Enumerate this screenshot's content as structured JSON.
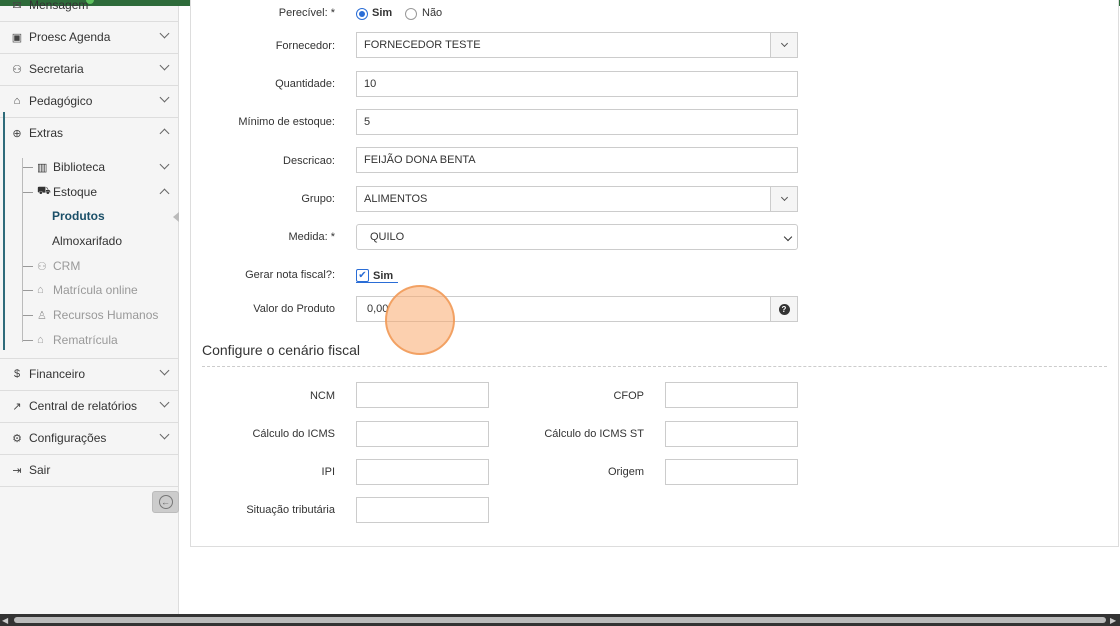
{
  "sidebar": {
    "top_partial": "Mensagem",
    "items": [
      {
        "label": "Proesc Agenda",
        "icon": "calendar-icon"
      },
      {
        "label": "Secretaria",
        "icon": "users-icon"
      },
      {
        "label": "Pedagógico",
        "icon": "graduation-cap-icon"
      },
      {
        "label": "Extras",
        "icon": "plus-circle-icon"
      },
      {
        "label": "Financeiro",
        "icon": "dollar-circle-icon"
      },
      {
        "label": "Central de relatórios",
        "icon": "line-chart-icon"
      },
      {
        "label": "Configurações",
        "icon": "gear-icon"
      },
      {
        "label": "Sair",
        "icon": "sign-out-icon"
      }
    ],
    "extras_sub": [
      {
        "label": "Biblioteca",
        "icon": "book-icon"
      },
      {
        "label": "Estoque",
        "icon": "truck-icon"
      },
      {
        "label": "Produtos"
      },
      {
        "label": "Almoxarifado"
      },
      {
        "label": "CRM",
        "icon": "users-icon"
      },
      {
        "label": "Matrícula online",
        "icon": "graduation-cap-icon"
      },
      {
        "label": "Recursos Humanos",
        "icon": "person-icon"
      },
      {
        "label": "Rematrícula",
        "icon": "graduation-cap-icon"
      }
    ]
  },
  "form": {
    "perecivel_label": "Perecível: *",
    "perecivel_yes": "Sim",
    "perecivel_no": "Não",
    "fornecedor_label": "Fornecedor:",
    "fornecedor_value": "FORNECEDOR TESTE",
    "quantidade_label": "Quantidade:",
    "quantidade_value": "10",
    "minimo_label": "Mínimo de estoque:",
    "minimo_value": "5",
    "descricao_label": "Descricao:",
    "descricao_value": "FEIJÃO DONA BENTA",
    "grupo_label": "Grupo:",
    "grupo_value": "ALIMENTOS",
    "medida_label": "Medida: *",
    "medida_value": "QUILO",
    "nota_label": "Gerar nota fiscal?:",
    "nota_value": "Sim",
    "valor_label": "Valor do Produto",
    "valor_value": "0,00"
  },
  "fiscal": {
    "title": "Configure o cenário fiscal",
    "ncm_label": "NCM",
    "cfop_label": "CFOP",
    "icms_label": "Cálculo do ICMS",
    "icms_st_label": "Cálculo do ICMS ST",
    "ipi_label": "IPI",
    "origem_label": "Origem",
    "situacao_label": "Situação tributária"
  }
}
